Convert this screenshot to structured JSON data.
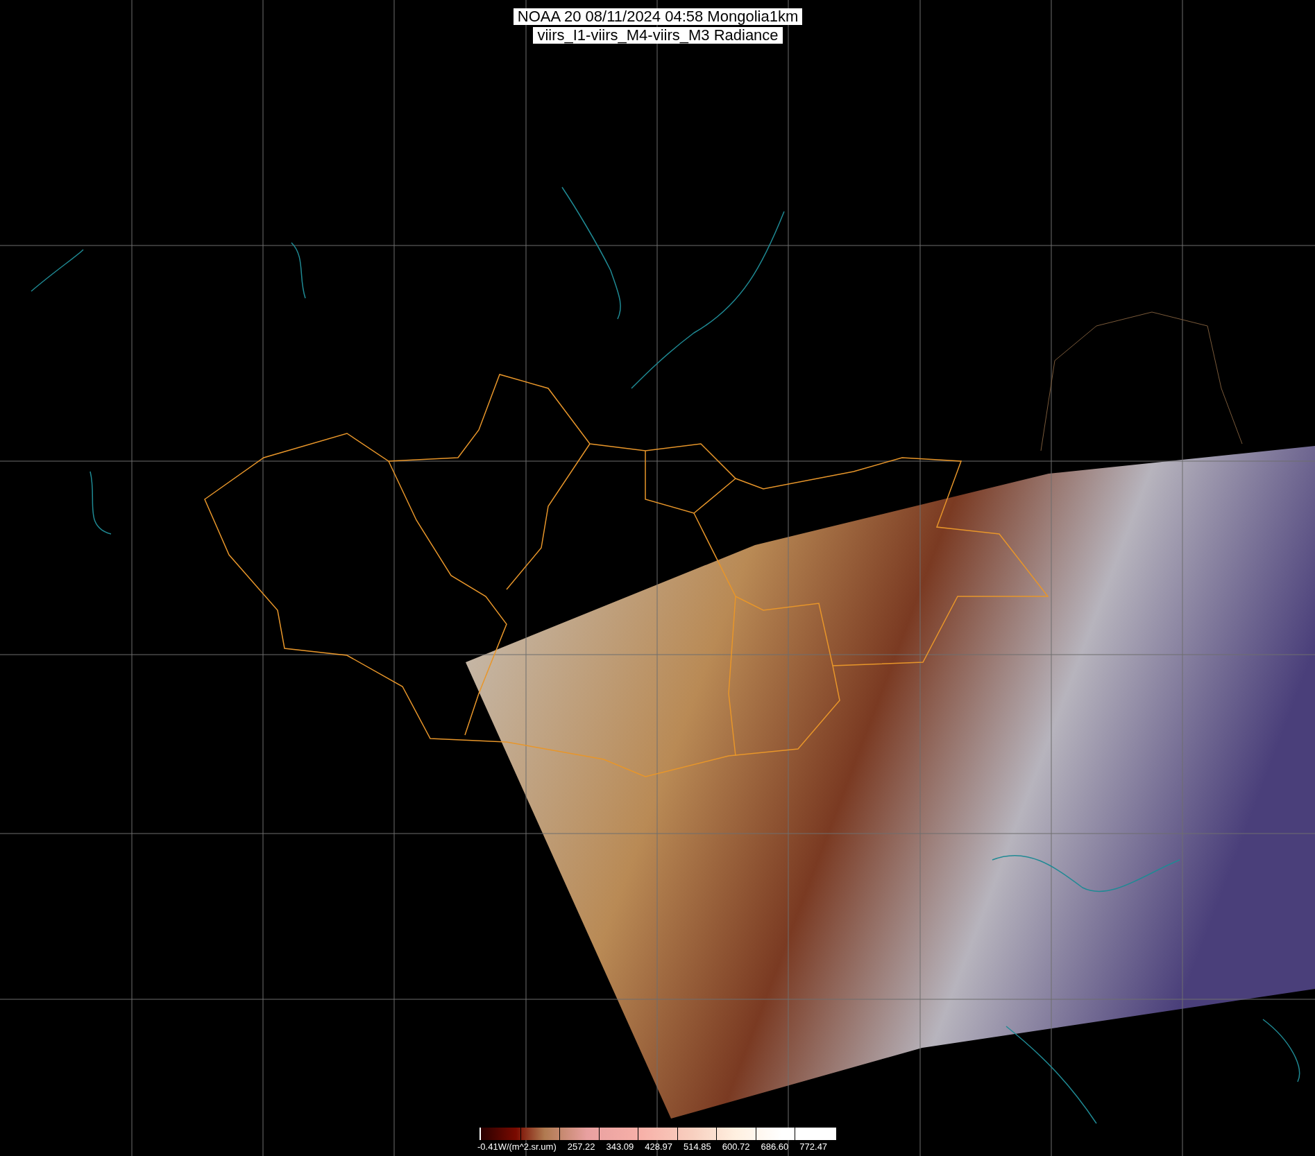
{
  "title": {
    "lines": [
      "NOAA 20 08/11/2024 04:58 Mongolia1km",
      "viirs_I1-viirs_M4-viirs_M3 Radiance"
    ]
  },
  "colorbar": {
    "labels": [
      "-0.41W/(m^2.sr.um)",
      "257.22",
      "343.09",
      "428.97",
      "514.85",
      "600.72",
      "686.60",
      "772.47"
    ]
  }
}
